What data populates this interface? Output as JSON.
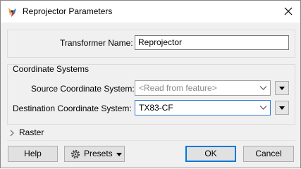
{
  "window": {
    "title": "Reprojector Parameters",
    "app_icon": "fme-transformer-icon",
    "close_icon": "close-icon"
  },
  "transformer": {
    "label": "Transformer Name:",
    "value": "Reprojector"
  },
  "coordinate_systems": {
    "group_title": "Coordinate Systems",
    "source": {
      "label": "Source Coordinate System:",
      "placeholder": "<Read from feature>",
      "value": ""
    },
    "destination": {
      "label": "Destination Coordinate System:",
      "value": "TX83-CF"
    }
  },
  "raster": {
    "label": "Raster",
    "expanded": false
  },
  "buttons": {
    "help": "Help",
    "presets": "Presets",
    "ok": "OK",
    "cancel": "Cancel"
  },
  "colors": {
    "accent": "#0078d7",
    "dialog_bg": "#f0f0f0"
  }
}
